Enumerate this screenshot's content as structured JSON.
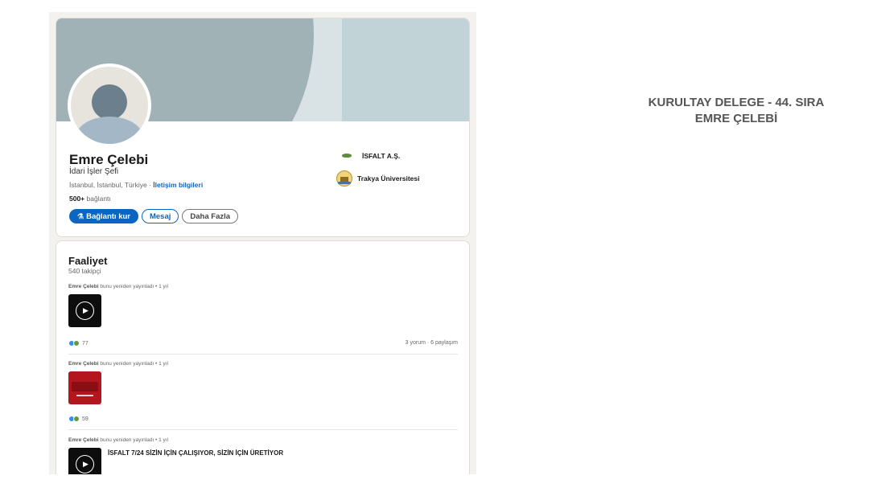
{
  "profile": {
    "name": "Emre Çelebi",
    "headline": "İdari İşler Şefi",
    "location": "İstanbul, İstanbul, Türkiye",
    "location_sep": "·",
    "contact_link": "İletişim bilgileri",
    "connections_count": "500+",
    "connections_label": "bağlantı",
    "buttons": {
      "connect": "Bağlantı kur",
      "message": "Mesaj",
      "more": "Daha Fazla"
    },
    "organizations": [
      {
        "name": "İSFALT A.Ş.",
        "logo": "isfalt-logo"
      },
      {
        "name": "Trakya Üniversitesi",
        "logo": "trakya-university-logo"
      }
    ]
  },
  "activity": {
    "title": "Faaliyet",
    "followers": "540 takipçi",
    "posts": [
      {
        "author": "Emre Çelebi",
        "meta": "bunu yeniden yayınladı • 1 yıl",
        "thumbnail": "video-play",
        "reactions": "77",
        "stats": "3 yorum · 6 paylaşım"
      },
      {
        "author": "Emre Çelebi",
        "meta": "bunu yeniden yayınladı • 1 yıl",
        "thumbnail": "red-anniversary-image",
        "reactions": "59"
      },
      {
        "author": "Emre Çelebi",
        "meta": "bunu yeniden yayınladı • 1 yıl",
        "thumbnail": "video-play",
        "title": "İSFALT 7/24 SİZİN İÇİN ÇALIŞIYOR, SİZİN İÇİN ÜRETİYOR"
      }
    ]
  },
  "caption": {
    "line1": "KURULTAY DELEGE - 44. SIRA",
    "line2": "EMRE ÇELEBİ"
  },
  "colors": {
    "accent": "#0a66c2",
    "banner": "#c2d3d8",
    "page_bg": "#f4f2ee"
  }
}
